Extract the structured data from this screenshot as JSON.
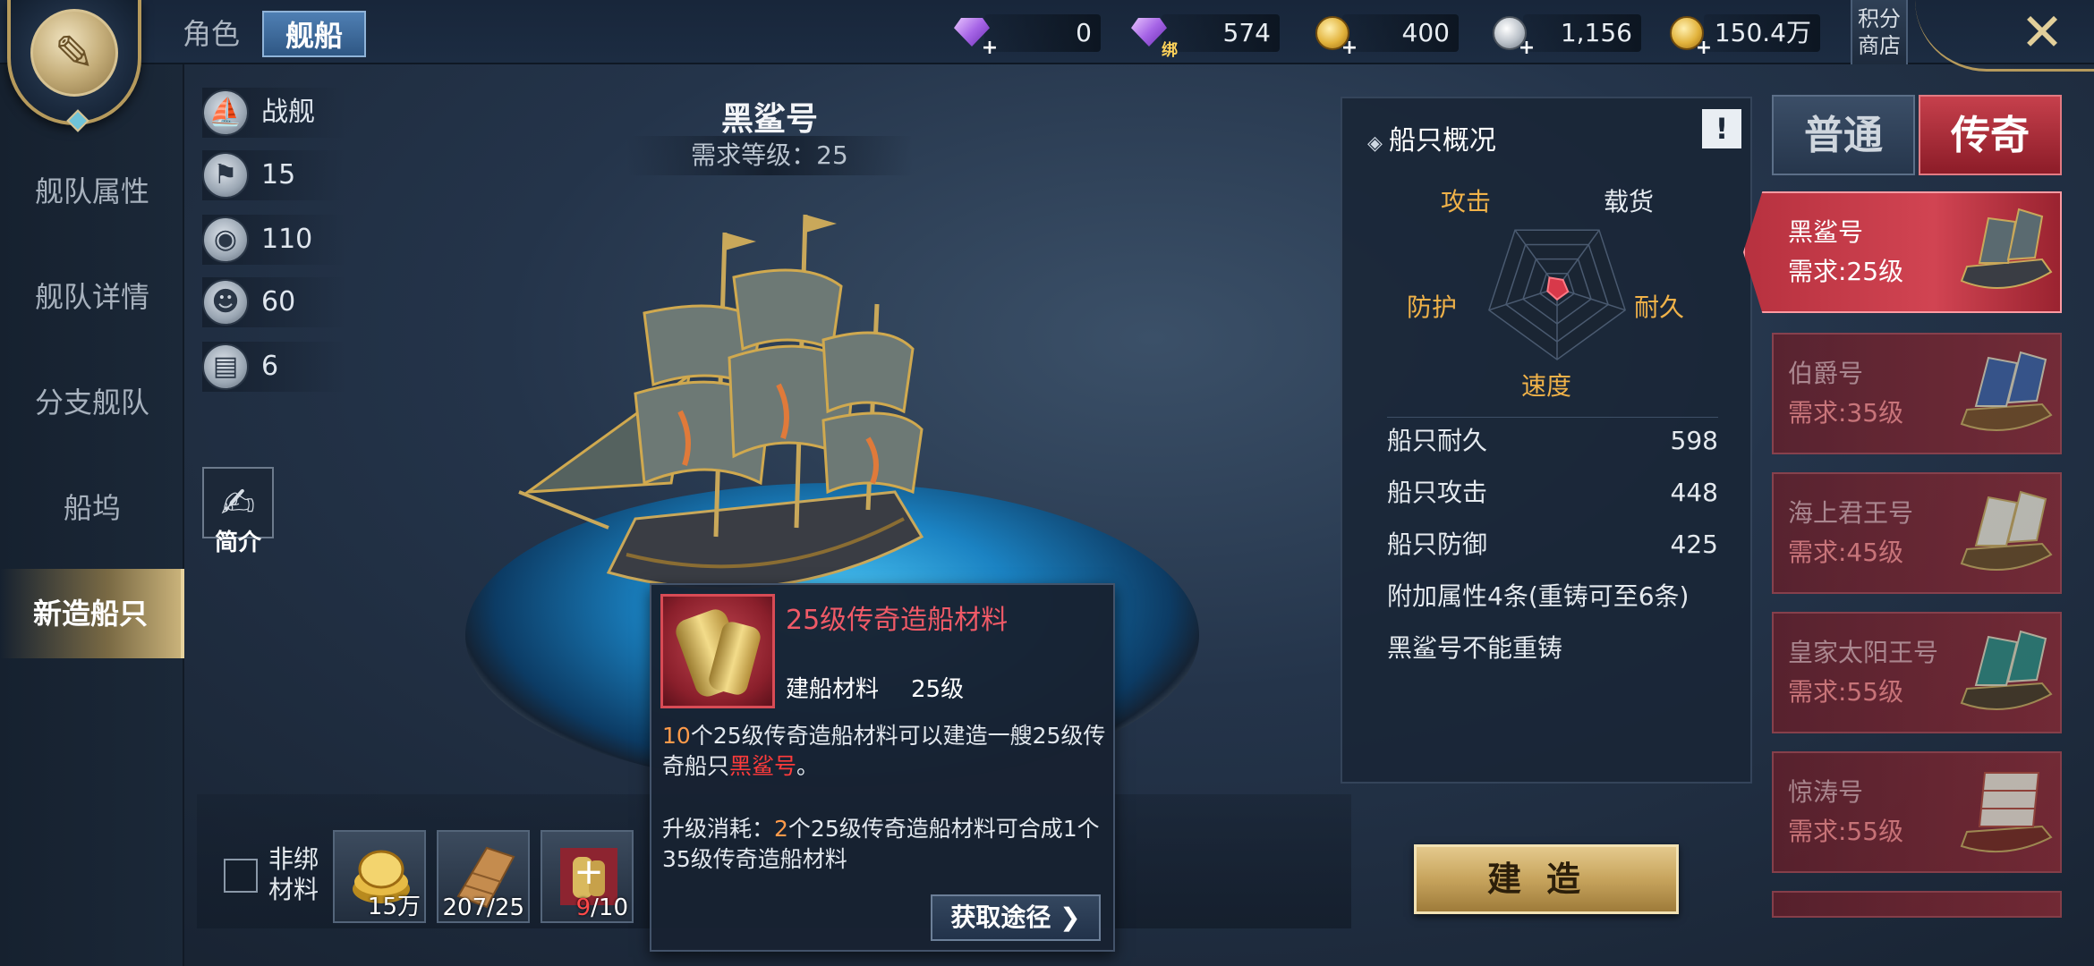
{
  "top_tabs": {
    "role": "角色",
    "ship": "舰船"
  },
  "currencies": [
    {
      "icon": "purple-diamond-icon",
      "value": "0"
    },
    {
      "icon": "bound-purple-diamond-icon",
      "bind_tag": "绑",
      "value": "574"
    },
    {
      "icon": "gold-coin-icon",
      "value": "400"
    },
    {
      "icon": "silver-coin-icon",
      "value": "1,156"
    },
    {
      "icon": "gold-coin-stack-icon",
      "value": "150.4万"
    }
  ],
  "shop": {
    "label": "积分商店"
  },
  "nav": {
    "items": [
      {
        "label": "舰队属性"
      },
      {
        "label": "舰队详情"
      },
      {
        "label": "分支舰队"
      },
      {
        "label": "船坞"
      },
      {
        "label": "新造船只"
      }
    ]
  },
  "stats": [
    {
      "icon": "warship-icon",
      "value": "战舰"
    },
    {
      "icon": "sail-icon",
      "value": "15"
    },
    {
      "icon": "supplies-icon",
      "value": "110"
    },
    {
      "icon": "sailor-icon",
      "value": "60"
    },
    {
      "icon": "cannon-icon",
      "value": "6"
    }
  ],
  "intro": {
    "label": "简介"
  },
  "ship": {
    "name": "黑鲨号",
    "requirement": "需求等级：25"
  },
  "materials": {
    "nonbind_label": "非绑材料",
    "slots": [
      {
        "icon": "gold-coins-icon",
        "count": "15万",
        "warn": "",
        "rest": ""
      },
      {
        "icon": "wood-planks-icon",
        "count": "207/25",
        "warn": "",
        "rest": ""
      },
      {
        "icon": "legend-material-icon",
        "count": "",
        "warn": "9",
        "rest": "/10"
      }
    ]
  },
  "tooltip": {
    "title": "25级传奇造船材料",
    "type": "建船材料",
    "level": "25级",
    "desc_count": "10",
    "desc_part1": "个25级传奇造船材料可以建造一艘25级传奇船只",
    "desc_ship": "黑鲨号",
    "desc_end": "。",
    "upgrade_label": "升级消耗：",
    "upgrade_count": "2",
    "upgrade_text": "个25级传奇造船材料可合成1个35级传奇造船材料",
    "button": "获取途径"
  },
  "overview": {
    "title": "船只概况",
    "info": "!",
    "radar": {
      "labels": {
        "attack": "攻击",
        "cargo": "载货",
        "durability": "耐久",
        "speed": "速度",
        "defense": "防护"
      },
      "levels": {
        "attack": 0.18,
        "cargo": 0.14,
        "durability": 0.16,
        "speed": 0.16,
        "defense": 0.14
      }
    },
    "rows": [
      {
        "label": "船只耐久",
        "value": "598"
      },
      {
        "label": "船只攻击",
        "value": "448"
      },
      {
        "label": "船只防御",
        "value": "425"
      }
    ],
    "extra": "附加属性4条(重铸可至6条)",
    "note": "黑鲨号不能重铸"
  },
  "build": {
    "label": "建造"
  },
  "ship_types": {
    "normal": "普通",
    "legend": "传奇"
  },
  "ship_list": [
    {
      "name": "黑鲨号",
      "req": "需求:25级"
    },
    {
      "name": "伯爵号",
      "req": "需求:35级"
    },
    {
      "name": "海上君王号",
      "req": "需求:45级"
    },
    {
      "name": "皇家太阳王号",
      "req": "需求:55级"
    },
    {
      "name": "惊涛号",
      "req": "需求:55级"
    }
  ],
  "colors": {
    "accent_gold": "#c9b27a",
    "legend_red": "#c6404c",
    "warning_red": "#ff3b3b",
    "highlight_orange": "#ff9b4a"
  }
}
